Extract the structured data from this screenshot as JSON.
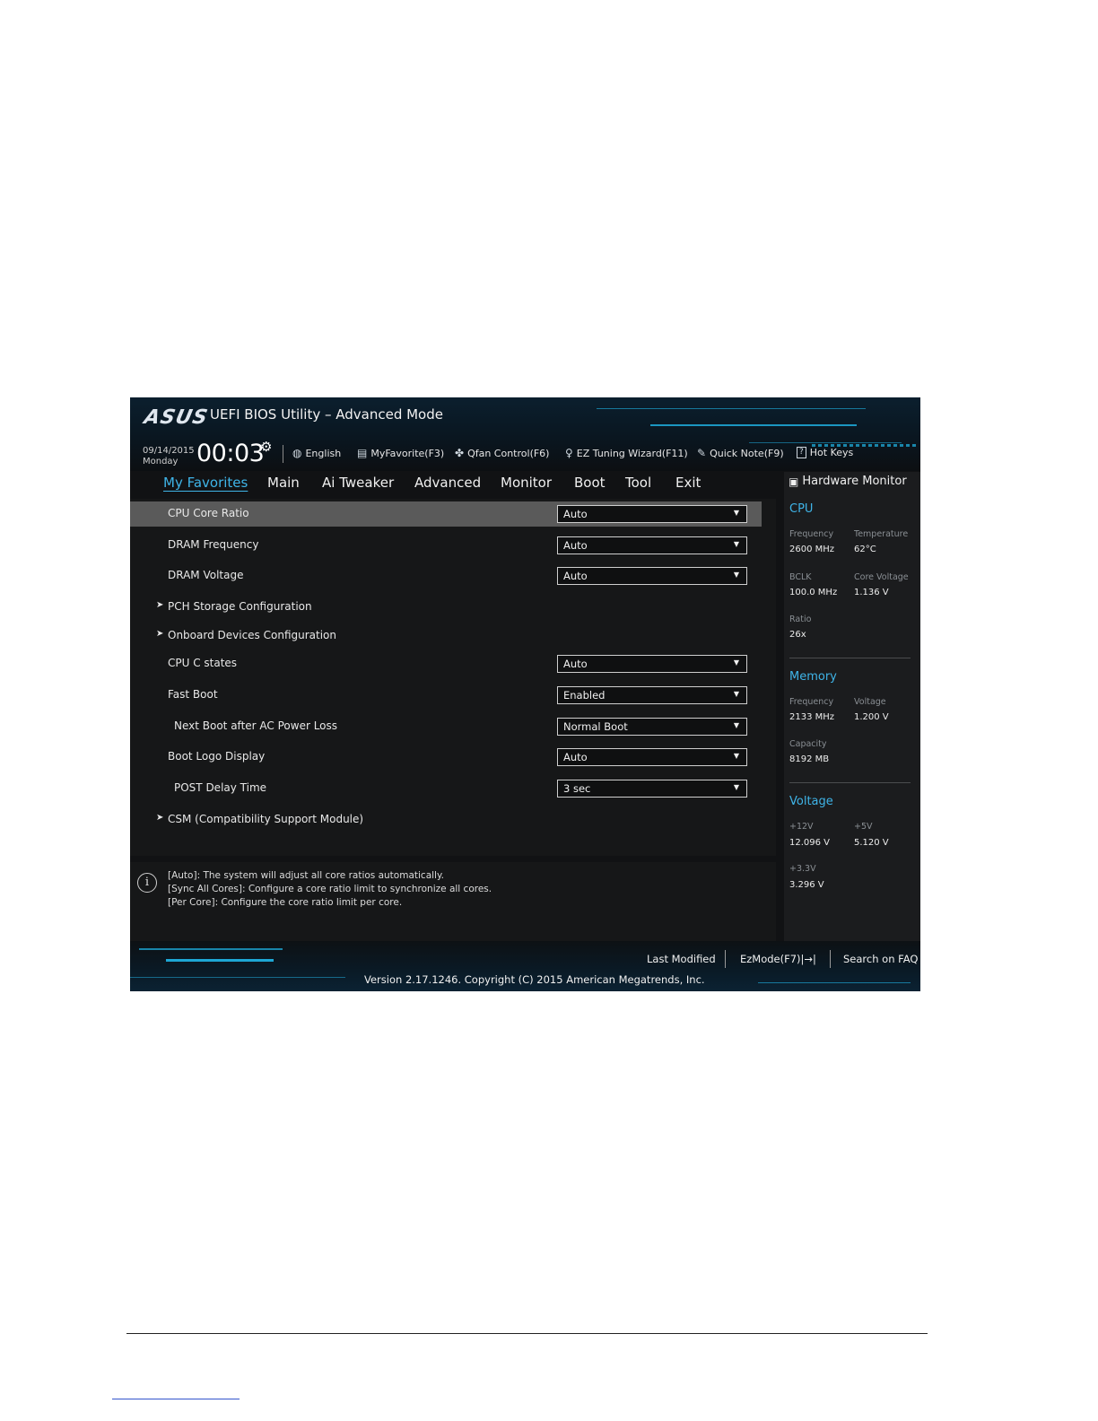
{
  "header": {
    "logo": "ASUS",
    "title": "UEFI BIOS Utility – Advanced Mode",
    "date": "09/14/2015",
    "day": "Monday",
    "time": "00:03"
  },
  "toolbar": [
    {
      "icon": "globe-icon",
      "label": "English"
    },
    {
      "icon": "favorite-list-icon",
      "label": "MyFavorite(F3)"
    },
    {
      "icon": "fan-icon",
      "label": "Qfan Control(F6)"
    },
    {
      "icon": "lightbulb-icon",
      "label": "EZ Tuning Wizard(F11)"
    },
    {
      "icon": "note-icon",
      "label": "Quick Note(F9)"
    },
    {
      "icon": "question-icon",
      "label": "Hot Keys"
    }
  ],
  "tabs": [
    "My Favorites",
    "Main",
    "Ai Tweaker",
    "Advanced",
    "Monitor",
    "Boot",
    "Tool",
    "Exit"
  ],
  "active_tab": "My Favorites",
  "settings": [
    {
      "label": "CPU Core Ratio",
      "value": "Auto"
    },
    {
      "label": "DRAM Frequency",
      "value": "Auto"
    },
    {
      "label": "DRAM Voltage",
      "value": "Auto"
    },
    {
      "label": "PCH Storage Configuration"
    },
    {
      "label": "Onboard Devices Configuration"
    },
    {
      "label": "CPU C states",
      "value": "Auto"
    },
    {
      "label": "Fast Boot",
      "value": "Enabled"
    },
    {
      "label": "Next Boot after AC Power Loss",
      "value": "Normal Boot"
    },
    {
      "label": "Boot Logo Display",
      "value": "Auto"
    },
    {
      "label": "POST Delay Time",
      "value": "3 sec"
    },
    {
      "label": "CSM (Compatibility Support Module)"
    }
  ],
  "help": {
    "lines": [
      "[Auto]: The system will adjust all core ratios automatically.",
      "[Sync All Cores]: Configure a core ratio limit to synchronize all cores.",
      "[Per Core]: Configure the core ratio limit per core."
    ]
  },
  "hardware_monitor": {
    "title": "Hardware Monitor",
    "cpu": {
      "title": "CPU",
      "frequency_label": "Frequency",
      "frequency": "2600 MHz",
      "temperature_label": "Temperature",
      "temperature": "62°C",
      "bclk_label": "BCLK",
      "bclk": "100.0 MHz",
      "core_voltage_label": "Core Voltage",
      "core_voltage": "1.136 V",
      "ratio_label": "Ratio",
      "ratio": "26x"
    },
    "memory": {
      "title": "Memory",
      "frequency_label": "Frequency",
      "frequency": "2133 MHz",
      "voltage_label": "Voltage",
      "voltage": "1.200 V",
      "capacity_label": "Capacity",
      "capacity": "8192 MB"
    },
    "voltage": {
      "title": "Voltage",
      "v12_label": "+12V",
      "v12": "12.096 V",
      "v5_label": "+5V",
      "v5": "5.120 V",
      "v33_label": "+3.3V",
      "v33": "3.296 V"
    }
  },
  "footer": {
    "last_modified": "Last Modified",
    "ezmode": "EzMode(F7)|→|",
    "search_faq": "Search on FAQ",
    "version": "Version 2.17.1246. Copyright (C) 2015 American Megatrends, Inc."
  },
  "colors": {
    "accent": "#3fb4e8",
    "background": "#111214",
    "selected_row": "#5a5a5a"
  }
}
